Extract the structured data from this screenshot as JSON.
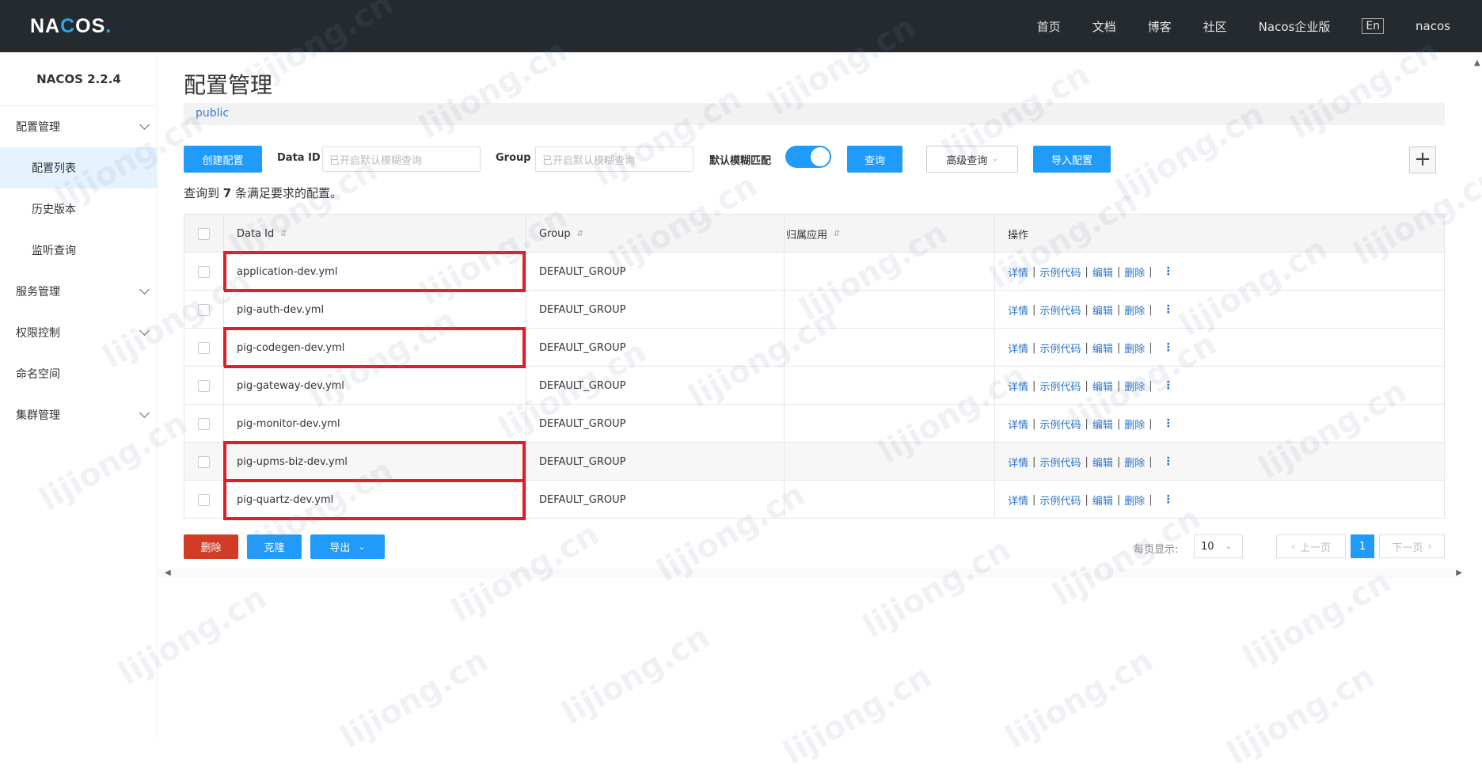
{
  "header": {
    "logo": "NACOS.",
    "nav": [
      "首页",
      "文档",
      "博客",
      "社区",
      "Nacos企业版"
    ],
    "lang": "En",
    "user": "nacos"
  },
  "sidebar": {
    "version": "NACOS 2.2.4",
    "items": [
      {
        "label": "配置管理",
        "expandable": true
      },
      {
        "label": "配置列表",
        "active": true
      },
      {
        "label": "历史版本"
      },
      {
        "label": "监听查询"
      },
      {
        "label": "服务管理",
        "expandable": true
      },
      {
        "label": "权限控制",
        "expandable": true
      },
      {
        "label": "命名空间"
      },
      {
        "label": "集群管理",
        "expandable": true
      }
    ]
  },
  "main": {
    "title": "配置管理",
    "namespace": "public",
    "toolbar": {
      "create_label": "创建配置",
      "data_id_label": "Data ID",
      "data_id_placeholder": "已开启默认模糊查询",
      "group_label": "Group",
      "group_placeholder": "已开启默认模糊查询",
      "fuzzy_label": "默认模糊匹配",
      "fuzzy_on": true,
      "query_label": "查询",
      "advanced_label": "高级查询",
      "import_label": "导入配置",
      "add_symbol": "+"
    },
    "result": {
      "prefix": "查询到",
      "count": "7",
      "suffix": "条满足要求的配置。"
    },
    "table": {
      "columns": [
        "Data Id",
        "Group",
        "归属应用",
        "操作"
      ],
      "rows": [
        {
          "data_id": "application-dev.yml",
          "group": "DEFAULT_GROUP",
          "app": "",
          "highlighted": true
        },
        {
          "data_id": "pig-auth-dev.yml",
          "group": "DEFAULT_GROUP",
          "app": "",
          "highlighted": false
        },
        {
          "data_id": "pig-codegen-dev.yml",
          "group": "DEFAULT_GROUP",
          "app": "",
          "highlighted": true
        },
        {
          "data_id": "pig-gateway-dev.yml",
          "group": "DEFAULT_GROUP",
          "app": "",
          "highlighted": false
        },
        {
          "data_id": "pig-monitor-dev.yml",
          "group": "DEFAULT_GROUP",
          "app": "",
          "highlighted": false
        },
        {
          "data_id": "pig-upms-biz-dev.yml",
          "group": "DEFAULT_GROUP",
          "app": "",
          "highlighted": true
        },
        {
          "data_id": "pig-quartz-dev.yml",
          "group": "DEFAULT_GROUP",
          "app": "",
          "highlighted": true
        }
      ],
      "ops": [
        "详情",
        "示例代码",
        "编辑",
        "删除"
      ]
    },
    "footer": {
      "delete_label": "删除",
      "clone_label": "克隆",
      "export_label": "导出",
      "page_size_label": "每页显示:",
      "page_size": "10",
      "prev_label": "上一页",
      "current_page": "1",
      "next_label": "下一页"
    }
  },
  "watermark": "lijiong.cn",
  "colors": {
    "accent": "#209bfa",
    "danger": "#d23c26",
    "highlight_box": "#e01e28",
    "topbar": "#252a2f"
  }
}
